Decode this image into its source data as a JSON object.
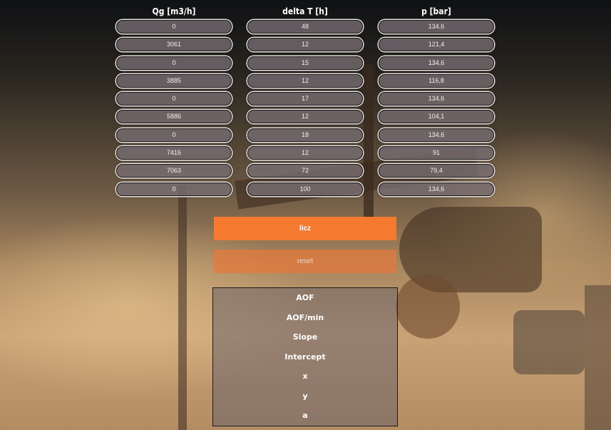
{
  "columns": [
    {
      "header": "Qg [m3/h]",
      "values": [
        "0",
        "3061",
        "0",
        "3885",
        "0",
        "5886",
        "0",
        "7416",
        "7063",
        "0"
      ]
    },
    {
      "header": "delta T [h]",
      "values": [
        "48",
        "12",
        "15",
        "12",
        "17",
        "12",
        "18",
        "12",
        "72",
        "100"
      ]
    },
    {
      "header": "p [bar]",
      "values": [
        "134,6",
        "121,4",
        "134,6",
        "116,8",
        "134,6",
        "104,1",
        "134,6",
        "91",
        "79,4",
        "134,6"
      ]
    }
  ],
  "buttons": {
    "calc_label": "licz",
    "reset_label": "reset"
  },
  "results": {
    "items": [
      "AOF",
      "AOF/min",
      "Slope",
      "Intercept",
      "x",
      "y",
      "a"
    ]
  },
  "colors": {
    "accent": "#f57a30",
    "reset": "#e6783c"
  }
}
